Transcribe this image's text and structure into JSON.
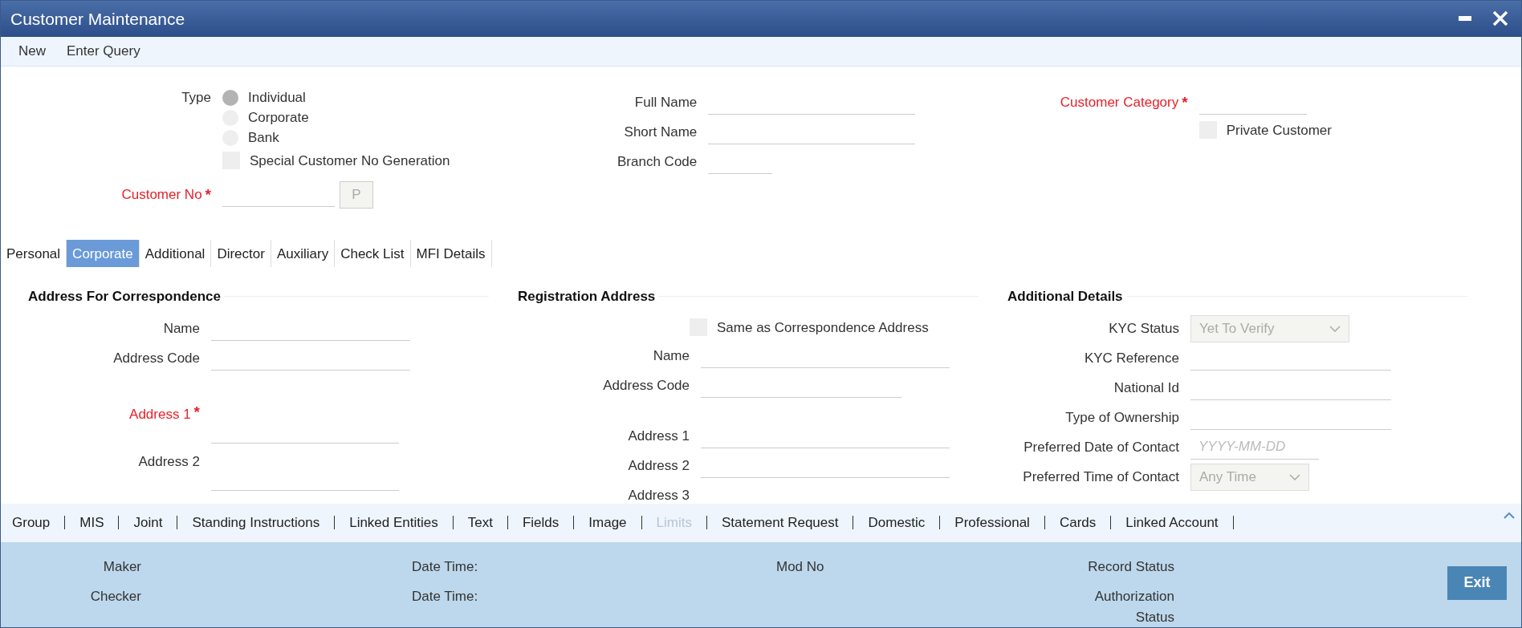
{
  "window": {
    "title": "Customer Maintenance"
  },
  "menu": [
    "New",
    "Enter Query"
  ],
  "header": {
    "columns": [
      [
        {
          "kind": "radio_group",
          "label": "Type",
          "options": [
            {
              "label": "Individual",
              "selected": true
            },
            {
              "label": "Corporate",
              "selected": false
            },
            {
              "label": "Bank",
              "selected": false
            }
          ]
        },
        {
          "kind": "checkbox",
          "label": "Special Customer No Generation",
          "checked": false
        },
        {
          "kind": "short_field",
          "label": "Customer No",
          "required": true,
          "marker": "*",
          "button": "P"
        }
      ],
      [
        {
          "kind": "field",
          "label": "Full Name",
          "required": false
        },
        {
          "kind": "field",
          "label": "Short Name",
          "required": false
        },
        {
          "kind": "short_field",
          "label": "Branch Code",
          "required": false
        }
      ],
      [
        {
          "kind": "field",
          "label": "Customer Category",
          "required": true,
          "marker": "*"
        },
        {
          "kind": "checkbox",
          "label": "Private Customer",
          "checked": false
        }
      ]
    ]
  },
  "tabs": [
    {
      "label": "Personal",
      "selected": false
    },
    {
      "label": "Corporate",
      "selected": true
    },
    {
      "label": "Additional",
      "selected": false
    },
    {
      "label": "Director",
      "selected": false
    },
    {
      "label": "Auxiliary",
      "selected": false
    },
    {
      "label": "Check List",
      "selected": false
    },
    {
      "label": "MFI Details",
      "selected": false
    }
  ],
  "sections": [
    {
      "title": "Address For Correspondence",
      "items": [
        {
          "kind": "field",
          "label": "Name",
          "required": false
        },
        {
          "kind": "field",
          "label": "Address Code",
          "required": false
        },
        {
          "kind": "address_block",
          "label": "Address 1",
          "required": true,
          "marker": "*"
        },
        {
          "kind": "address_block",
          "label": "Address 2",
          "required": false
        }
      ]
    },
    {
      "title": "Registration Address",
      "items": [
        {
          "kind": "checkbox",
          "label": "Same as Correspondence Address",
          "checked": false
        },
        {
          "kind": "field",
          "label": "Name",
          "required": false
        },
        {
          "kind": "short_field",
          "label": "Address Code",
          "required": false
        },
        {
          "kind": "address_line",
          "label": "Address 1",
          "required": false
        },
        {
          "kind": "field",
          "label": "Address 2",
          "required": false
        },
        {
          "kind": "label",
          "label": "Address 3",
          "required": false
        }
      ]
    },
    {
      "title": "Additional Details",
      "items": [
        {
          "kind": "select",
          "label": "KYC Status",
          "value": "Yet To Verify"
        },
        {
          "kind": "field",
          "label": "KYC Reference",
          "required": false
        },
        {
          "kind": "field",
          "label": "National Id",
          "required": false
        },
        {
          "kind": "field",
          "label": "Type of Ownership",
          "required": false
        },
        {
          "kind": "date",
          "label": "Preferred Date of Contact",
          "placeholder": "YYYY-MM-DD"
        },
        {
          "kind": "short_select",
          "label": "Preferred Time of Contact",
          "value": "Any Time"
        }
      ]
    }
  ],
  "links": [
    {
      "label": "Group",
      "disabled": false
    },
    {
      "label": "MIS",
      "disabled": false
    },
    {
      "label": "Joint",
      "disabled": false
    },
    {
      "label": "Standing Instructions",
      "disabled": false
    },
    {
      "label": "Linked Entities",
      "disabled": false
    },
    {
      "label": "Text",
      "disabled": false
    },
    {
      "label": "Fields",
      "disabled": false
    },
    {
      "label": "Image",
      "disabled": false
    },
    {
      "label": "Limits",
      "disabled": true
    },
    {
      "label": "Statement Request",
      "disabled": false
    },
    {
      "label": "Domestic",
      "disabled": false
    },
    {
      "label": "Professional",
      "disabled": false
    },
    {
      "label": "Cards",
      "disabled": false
    },
    {
      "label": "Linked Account",
      "disabled": false
    }
  ],
  "audit": {
    "maker": "Maker",
    "maker_date_time": "Date Time:",
    "mod_no": "Mod No",
    "record_status": "Record Status",
    "checker": "Checker",
    "checker_date_time": "Date Time:",
    "authorization_status": "Authorization Status"
  },
  "exit_button": "Exit"
}
